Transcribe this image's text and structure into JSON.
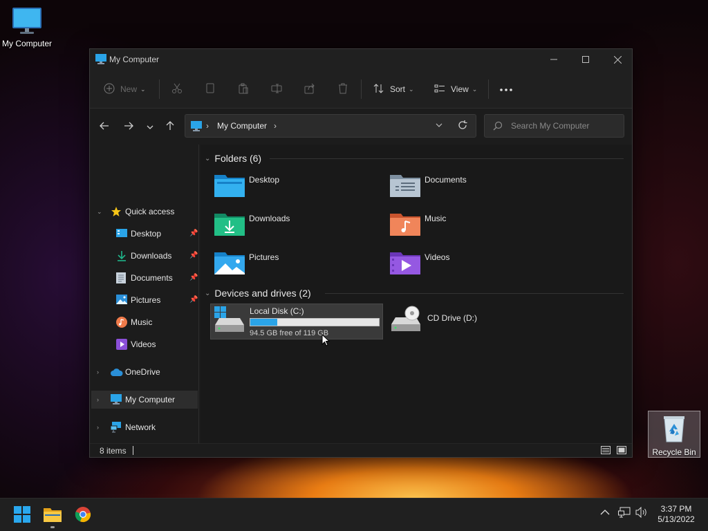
{
  "desktop": {
    "icons": [
      {
        "label": "My Computer"
      },
      {
        "label": "Recycle Bin"
      }
    ]
  },
  "window": {
    "title": "My Computer",
    "commandbar": {
      "new_label": "New",
      "sort_label": "Sort",
      "view_label": "View"
    },
    "address": {
      "crumb": "My Computer"
    },
    "search": {
      "placeholder": "Search My Computer"
    },
    "sidebar": {
      "quick_access": "Quick access",
      "items": [
        {
          "label": "Desktop",
          "pinned": true
        },
        {
          "label": "Downloads",
          "pinned": true
        },
        {
          "label": "Documents",
          "pinned": true
        },
        {
          "label": "Pictures",
          "pinned": true
        },
        {
          "label": "Music",
          "pinned": false
        },
        {
          "label": "Videos",
          "pinned": false
        }
      ],
      "onedrive": "OneDrive",
      "my_computer": "My Computer",
      "network": "Network"
    },
    "content": {
      "folders_header": "Folders (6)",
      "folders": [
        {
          "name": "Desktop",
          "icon": "desktop-folder-icon"
        },
        {
          "name": "Documents",
          "icon": "documents-folder-icon"
        },
        {
          "name": "Downloads",
          "icon": "downloads-folder-icon"
        },
        {
          "name": "Music",
          "icon": "music-folder-icon"
        },
        {
          "name": "Pictures",
          "icon": "pictures-folder-icon"
        },
        {
          "name": "Videos",
          "icon": "videos-folder-icon"
        }
      ],
      "drives_header": "Devices and drives (2)",
      "drives": [
        {
          "name": "Local Disk (C:)",
          "free_text": "94.5 GB free of 119 GB",
          "used_fraction": 0.21
        },
        {
          "name": "CD Drive (D:)"
        }
      ]
    },
    "status": {
      "item_count": "8 items"
    }
  },
  "taskbar": {
    "clock_time": "3:37 PM",
    "clock_date": "5/13/2022"
  },
  "colors": {
    "accent": "#2aa4e8",
    "window_bg": "#1c1c1c",
    "taskbar_bg": "#202020"
  }
}
